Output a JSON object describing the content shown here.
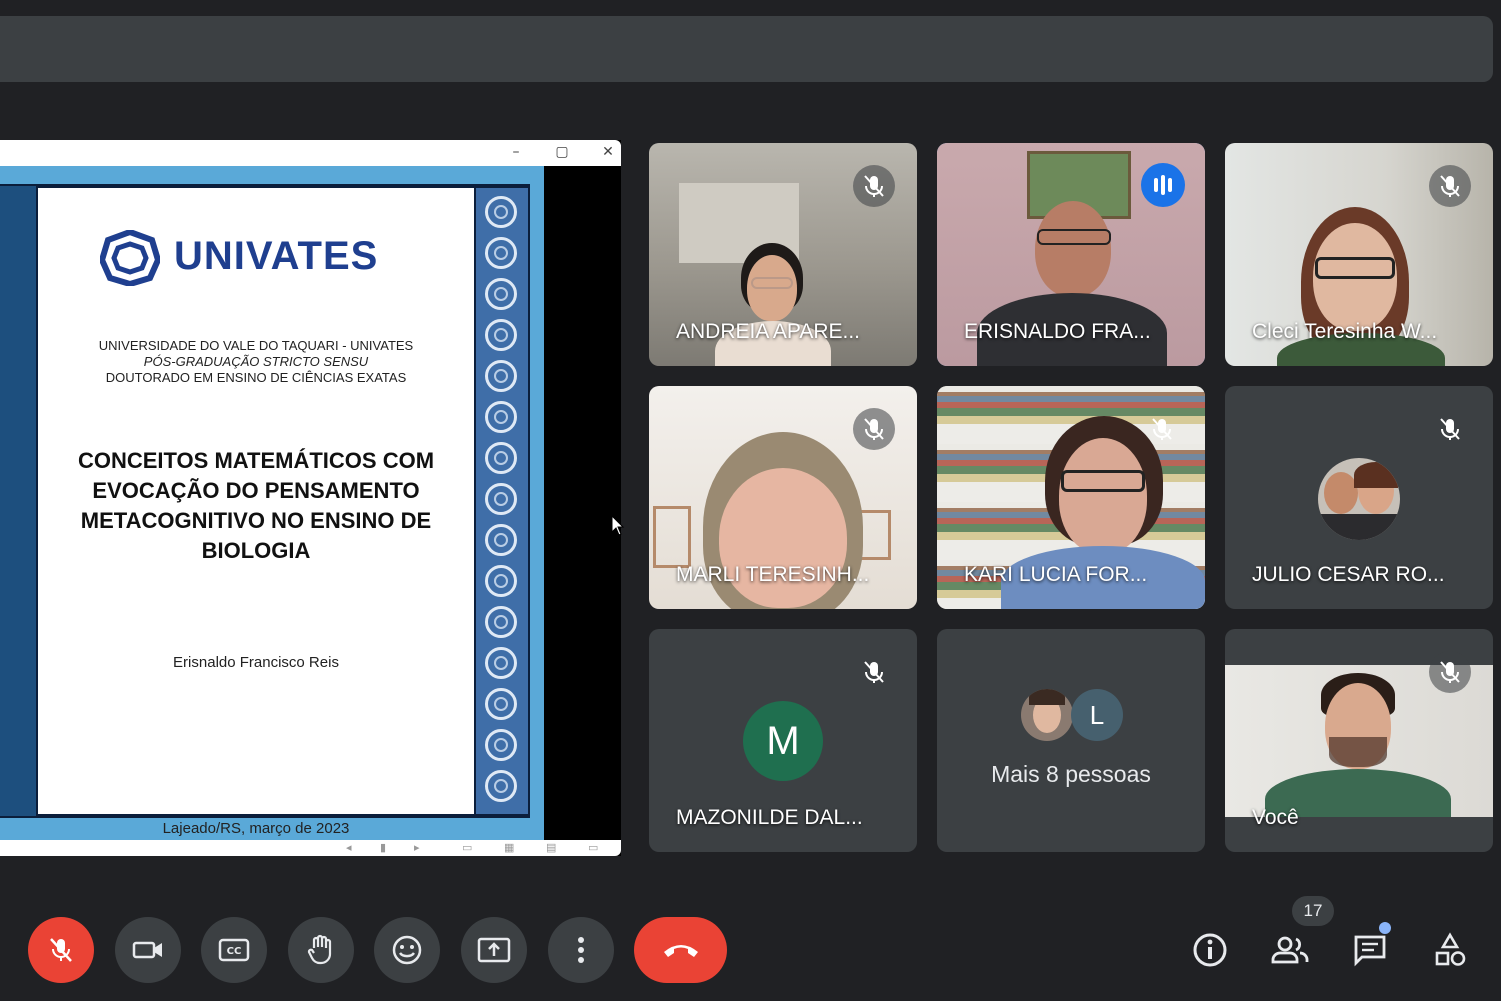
{
  "slide": {
    "logo_text": "UNIVATES",
    "university_lines": [
      "UNIVERSIDADE DO VALE DO TAQUARI - UNIVATES",
      "PÓS-GRADUAÇÃO STRICTO SENSU",
      "DOUTORADO EM ENSINO DE CIÊNCIAS EXATAS"
    ],
    "title": "CONCEITOS MATEMÁTICOS COM EVOCAÇÃO DO PENSAMENTO METACOGNITIVO NO ENSINO DE BIOLOGIA",
    "author": "Erisnaldo Francisco Reis",
    "place_date": "Lajeado/RS, março de 2023"
  },
  "window_buttons": [
    "minimize",
    "maximize",
    "close"
  ],
  "participants": [
    {
      "name": "ANDREIA APARE...",
      "muted": true
    },
    {
      "name": "ERISNALDO FRA...",
      "muted": false,
      "speaking": true
    },
    {
      "name": "Cleci Teresinha W...",
      "muted": true
    },
    {
      "name": "MARLI TERESINH...",
      "muted": true
    },
    {
      "name": "KARI LUCIA FOR...",
      "muted": true
    },
    {
      "name": "JULIO CESAR RO...",
      "muted": true
    },
    {
      "name": "MAZONILDE DAL...",
      "muted": true,
      "avatar_letter": "M"
    },
    {
      "more_avatar_letter": "L",
      "more_text": "Mais 8 pessoas"
    },
    {
      "name": "Você",
      "muted": true
    }
  ],
  "controls": [
    "mic-off",
    "camera",
    "captions",
    "raise-hand",
    "emoji",
    "present",
    "more-options",
    "end-call"
  ],
  "right_controls": {
    "participant_count": "17",
    "items": [
      "info",
      "people",
      "chat",
      "activities"
    ]
  },
  "colors": {
    "background": "#202124",
    "tile": "#3c4043",
    "danger": "#ea4335",
    "speaking_blue": "#1a73e8",
    "highlight": "#8ab4f8"
  }
}
